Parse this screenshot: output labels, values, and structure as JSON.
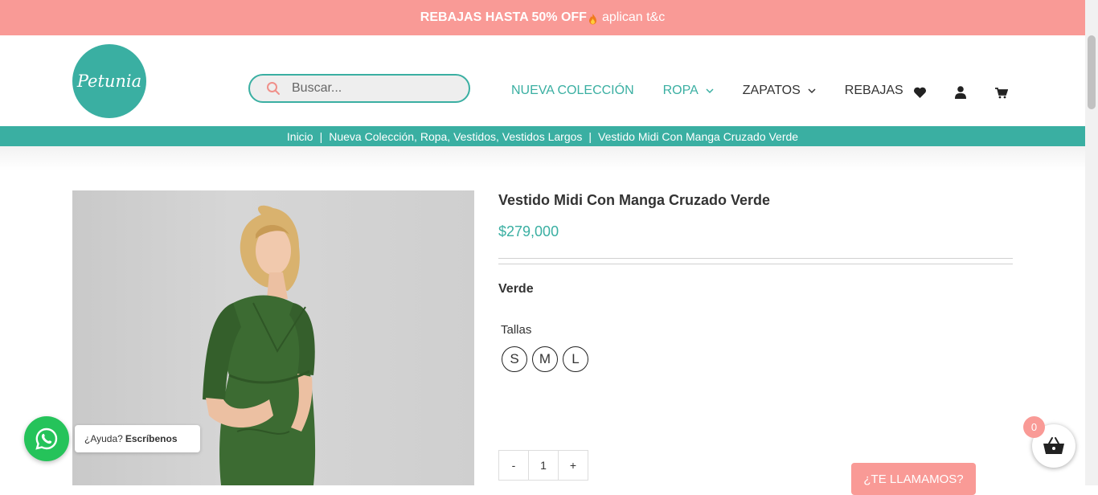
{
  "promo": {
    "bold": "REBAJAS HASTA 50% OFF",
    "rest": "aplican t&c"
  },
  "brand": {
    "logo_text": "Petunia"
  },
  "search": {
    "placeholder": "Buscar..."
  },
  "nav": {
    "items": [
      {
        "label": "NUEVA COLECCIÓN"
      },
      {
        "label": "ROPA"
      },
      {
        "label": "ZAPATOS"
      },
      {
        "label": "REBAJAS"
      }
    ],
    "icons": [
      "heart-icon",
      "user-icon",
      "cart-icon"
    ]
  },
  "breadcrumb": {
    "home": "Inicio",
    "categories": "Nueva Colección, Ropa, Vestidos, Vestidos Largos",
    "current": "Vestido Midi Con Manga Cruzado Verde",
    "separator": "|"
  },
  "product": {
    "title": "Vestido Midi Con Manga Cruzado Verde",
    "price": "$279,000",
    "color": "Verde",
    "sizes_label": "Tallas",
    "sizes": [
      "S",
      "M",
      "L"
    ],
    "quantity": "1",
    "minus": "-",
    "plus": "+"
  },
  "callback": {
    "label": "¿TE LLAMAMOS?"
  },
  "whatsapp": {
    "prefix": "¿Ayuda?",
    "cta": "Escríbenos"
  },
  "cart": {
    "count": "0"
  },
  "colors": {
    "teal": "#3aafa2",
    "promo": "#f99a96",
    "whatsapp": "#25c35a",
    "dress": "#3c6b32"
  }
}
